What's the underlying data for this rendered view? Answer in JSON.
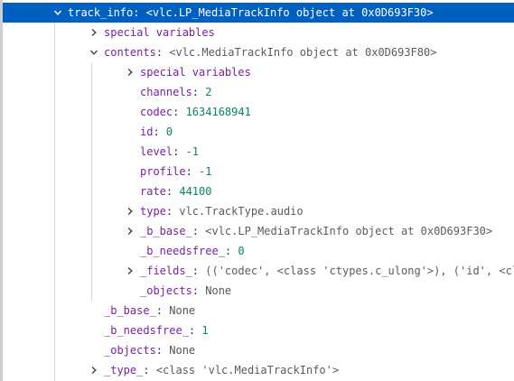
{
  "rows": [
    {
      "key": "track_info",
      "sep": ": ",
      "value": "<vlc.LP_MediaTrackInfo object at 0x0D693F30>",
      "vtype": "obj",
      "chevron": "down",
      "selected": true
    },
    {
      "key": "special variables",
      "sep": "",
      "value": "",
      "vtype": "obj",
      "chevron": "right"
    },
    {
      "key": "contents",
      "sep": ": ",
      "value": "<vlc.MediaTrackInfo object at 0x0D693F80>",
      "vtype": "obj",
      "chevron": "down"
    },
    {
      "key": "special variables",
      "sep": "",
      "value": "",
      "vtype": "obj",
      "chevron": "right"
    },
    {
      "key": "channels",
      "sep": ": ",
      "value": "2",
      "vtype": "num",
      "chevron": "none"
    },
    {
      "key": "codec",
      "sep": ": ",
      "value": "1634168941",
      "vtype": "num",
      "chevron": "none"
    },
    {
      "key": "id",
      "sep": ": ",
      "value": "0",
      "vtype": "num",
      "chevron": "none"
    },
    {
      "key": "level",
      "sep": ": ",
      "value": "-1",
      "vtype": "num",
      "chevron": "none"
    },
    {
      "key": "profile",
      "sep": ": ",
      "value": "-1",
      "vtype": "num",
      "chevron": "none"
    },
    {
      "key": "rate",
      "sep": ": ",
      "value": "44100",
      "vtype": "num",
      "chevron": "none"
    },
    {
      "key": "type",
      "sep": ": ",
      "value": "vlc.TrackType.audio",
      "vtype": "obj",
      "chevron": "right"
    },
    {
      "key": "_b_base_",
      "sep": ": ",
      "value": "<vlc.LP_MediaTrackInfo object at 0x0D693F30>",
      "vtype": "obj",
      "chevron": "right"
    },
    {
      "key": "_b_needsfree_",
      "sep": ": ",
      "value": "0",
      "vtype": "num",
      "chevron": "none"
    },
    {
      "key": "_fields_",
      "sep": ": ",
      "value": "(('codec', <class 'ctypes.c_ulong'>), ('id', <cl",
      "vtype": "obj",
      "chevron": "right"
    },
    {
      "key": "_objects",
      "sep": ": ",
      "value": "None",
      "vtype": "none",
      "chevron": "none"
    },
    {
      "key": "_b_base_",
      "sep": ": ",
      "value": "None",
      "vtype": "none",
      "chevron": "none"
    },
    {
      "key": "_b_needsfree_",
      "sep": ": ",
      "value": "1",
      "vtype": "num",
      "chevron": "none"
    },
    {
      "key": "_objects",
      "sep": ": ",
      "value": "None",
      "vtype": "none",
      "chevron": "none"
    },
    {
      "key": "_type_",
      "sep": ": ",
      "value": "<class 'vlc.MediaTrackInfo'>",
      "vtype": "obj",
      "chevron": "right"
    }
  ],
  "colors": {
    "selection": "#0060c0",
    "key": "#7a1fa2",
    "number": "#098658",
    "text": "#444444"
  }
}
